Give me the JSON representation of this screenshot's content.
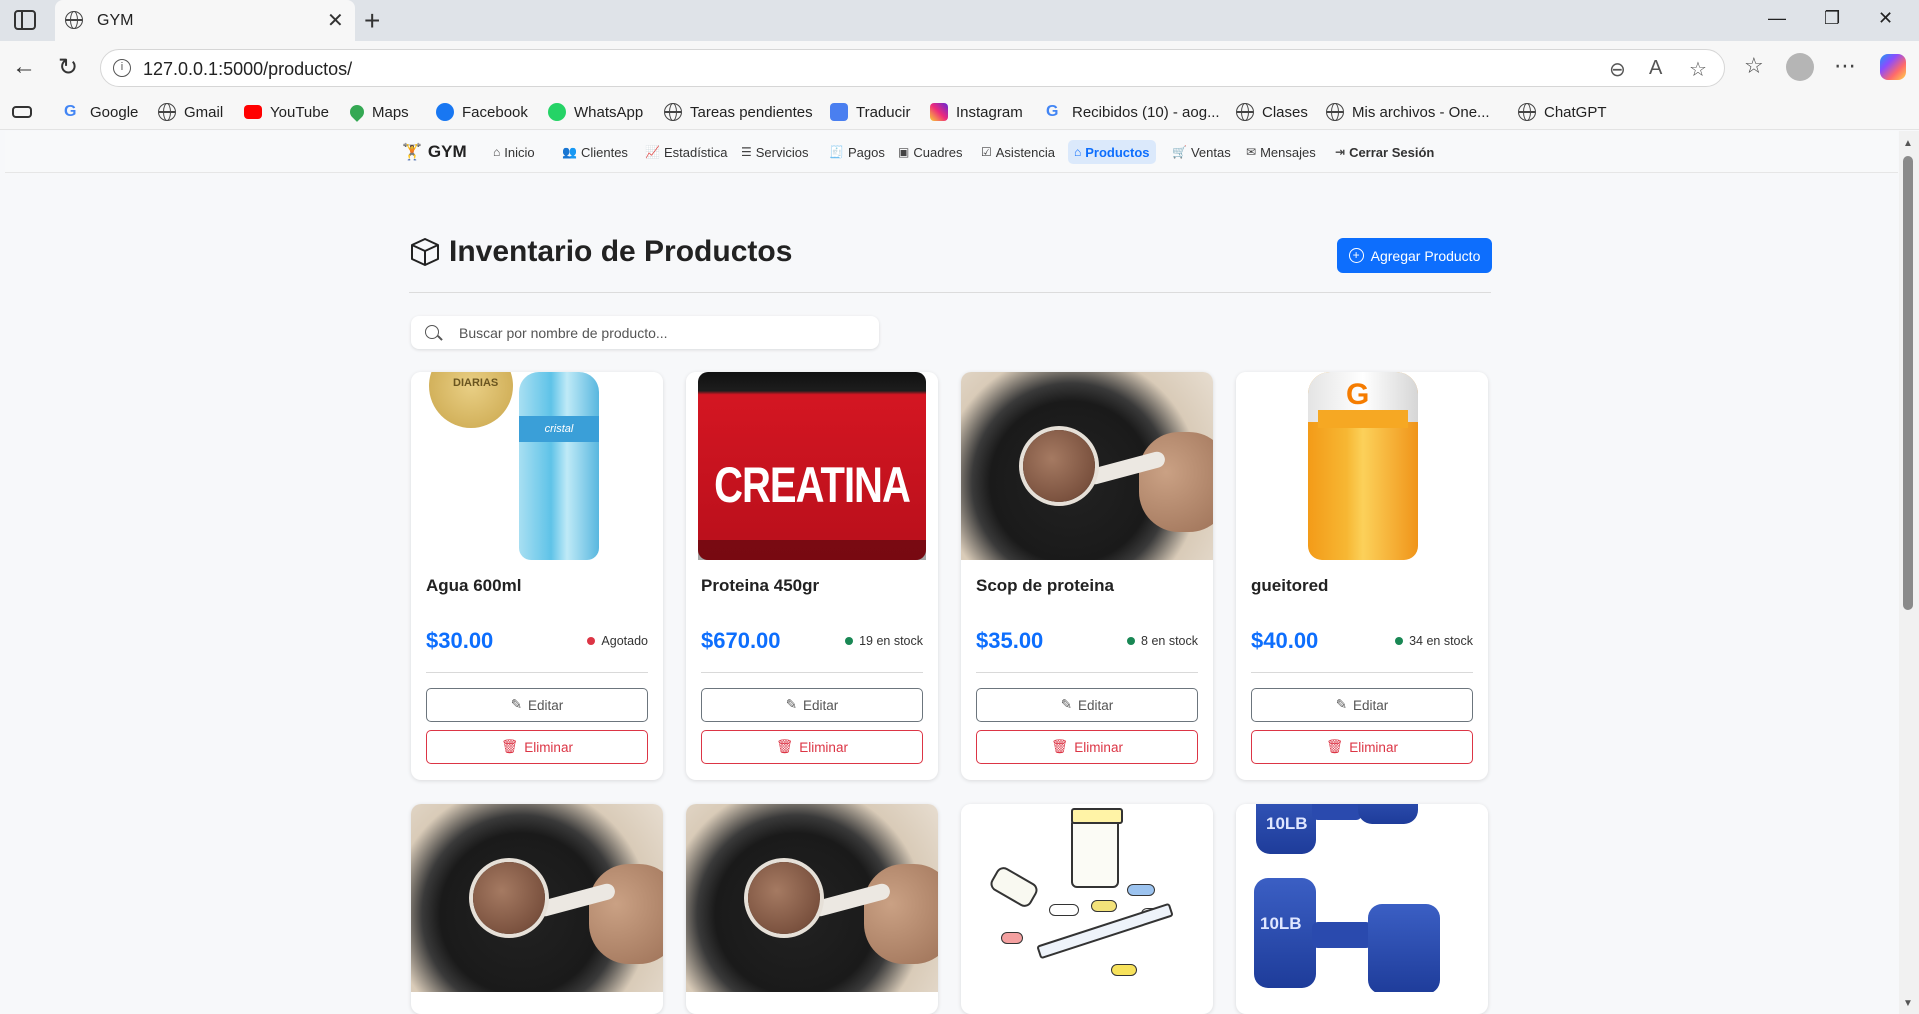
{
  "browser": {
    "tab_title": "GYM",
    "url": "127.0.0.1:5000/productos/",
    "bookmarks": [
      "Google",
      "Gmail",
      "YouTube",
      "Maps",
      "Facebook",
      "WhatsApp",
      "Tareas pendientes",
      "Traducir",
      "Instagram",
      "Recibidos (10) - aog...",
      "Clases",
      "Mis archivos - One...",
      "ChatGPT"
    ]
  },
  "navbar": {
    "brand": "GYM",
    "items": [
      "Inicio",
      "Clientes",
      "Estadística",
      "Servicios",
      "Pagos",
      "Cuadres",
      "Asistencia",
      "Productos",
      "Ventas",
      "Mensajes",
      "Cerrar Sesión"
    ],
    "active": "Productos"
  },
  "page": {
    "title": "Inventario de Productos",
    "add_button": "Agregar Producto",
    "search_placeholder": "Buscar por nombre de producto..."
  },
  "products": [
    {
      "name": "Agua 600ml",
      "price": "$30.00",
      "stock": "Agotado",
      "status_color": "#dc3545",
      "image": "water-bottle"
    },
    {
      "name": "Proteina 450gr",
      "price": "$670.00",
      "stock": "19 en stock",
      "status_color": "#198754",
      "image": "creatina-tub"
    },
    {
      "name": "Scop de proteina",
      "price": "$35.00",
      "stock": "8 en stock",
      "status_color": "#198754",
      "image": "protein-scoop"
    },
    {
      "name": "gueitored",
      "price": "$40.00",
      "stock": "34 en stock",
      "status_color": "#198754",
      "image": "gatorade-bottle"
    }
  ],
  "products_row2_images": [
    "protein-scoop",
    "protein-scoop",
    "pills",
    "dumbbells"
  ],
  "image_texts": {
    "medal": "DIARIAS",
    "water_label": "cristal",
    "creatina": "CREATINA",
    "dumbbell": "10LB"
  },
  "card_actions": {
    "edit": "Editar",
    "delete": "Eliminar"
  },
  "colors": {
    "primary": "#0d6efd",
    "danger": "#dc3545",
    "success": "#198754"
  }
}
